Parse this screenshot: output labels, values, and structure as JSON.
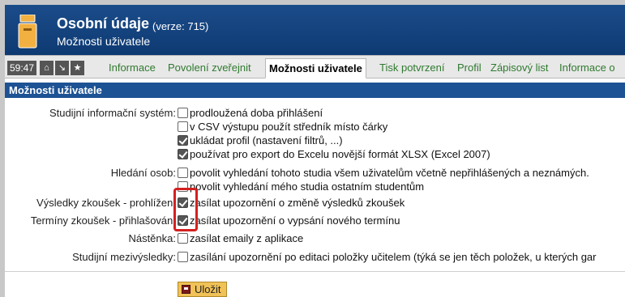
{
  "header": {
    "title": "Osobní údaje",
    "version": "(verze: 715)",
    "subtitle": "Možnosti uživatele"
  },
  "toolbar": {
    "timer": "59:47",
    "buttons": [
      {
        "icon": "home-icon",
        "glyph": "⌂"
      },
      {
        "icon": "collapse-icon",
        "glyph": "↘"
      },
      {
        "icon": "star-icon",
        "glyph": "★"
      }
    ],
    "tabs": [
      {
        "label": "Informace"
      },
      {
        "label": "Povolení zveřejnit"
      },
      {
        "label": "Možnosti uživatele"
      },
      {
        "label": "Tisk potvrzení"
      },
      {
        "label": "Profil"
      },
      {
        "label": "Zápisový list"
      },
      {
        "label": "Informace o"
      }
    ]
  },
  "section": {
    "title": "Možnosti uživatele"
  },
  "labels": {
    "sis": "Studijní informační systém:",
    "search": "Hledání osob:",
    "exam_results": "Výsledky zkoušek - prohlížení",
    "exam_dates": "Termíny zkoušek - přihlašování",
    "board": "Nástěnka:",
    "interim": "Studijní mezivýsledky:"
  },
  "options": {
    "extended_login": {
      "label": "prodloužená doba přihlášení",
      "checked": false
    },
    "csv_semicolon": {
      "label": "v CSV výstupu použít středník místo čárky",
      "checked": false
    },
    "save_profile": {
      "label": "ukládat profil (nastavení filtrů, ...)",
      "checked": true
    },
    "xlsx_export": {
      "label": "používat pro export do Excelu novější formát XLSX (Excel 2007)",
      "checked": true
    },
    "allow_search_all": {
      "label": "povolit vyhledání tohoto studia všem uživatelům včetně nepřihlášených a neznámých.",
      "checked": false
    },
    "allow_search_students": {
      "label": "povolit vyhledání mého studia ostatním studentům",
      "checked": false
    },
    "notify_result_change": {
      "label": "zasílat upozornění o změně výsledků zkoušek",
      "checked": true
    },
    "notify_new_date": {
      "label": "zasílat upozornění o vypsání nového termínu",
      "checked": true
    },
    "send_emails": {
      "label": "zasílat emaily z aplikace",
      "checked": false
    },
    "interim_notify": {
      "label": "zasílání upozornění po editaci položky učitelem (týká se jen těch položek, u kterých gar",
      "checked": false
    }
  },
  "save_label": "Uložit"
}
